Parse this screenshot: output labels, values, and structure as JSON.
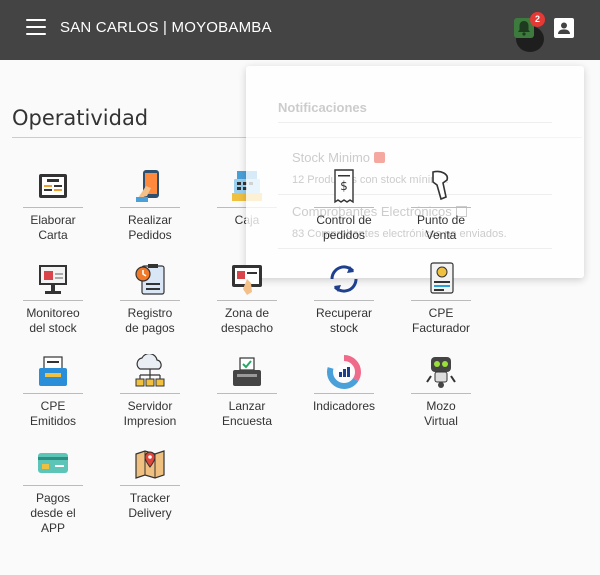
{
  "header": {
    "title": "SAN CARLOS | MOYOBAMBA",
    "notification_count": "2",
    "icons": [
      "menu-icon",
      "bell-icon",
      "user-icon"
    ]
  },
  "section": {
    "title": "Operatividad"
  },
  "tiles": [
    {
      "label": "Elaborar\nCarta",
      "icon": "menu-board-icon"
    },
    {
      "label": "Realizar\nPedidos",
      "icon": "tablet-hand-icon"
    },
    {
      "label": "Caja",
      "icon": "cash-register-icon"
    },
    {
      "label": "Control de\npedidos",
      "icon": "receipt-icon"
    },
    {
      "label": "Punto de\nVenta",
      "icon": "barcode-scanner-icon"
    },
    {
      "label": "Monitoreo\ndel stock",
      "icon": "monitor-chart-icon"
    },
    {
      "label": "Registro\nde pagos",
      "icon": "clipboard-clock-icon"
    },
    {
      "label": "Zona de\ndespacho",
      "icon": "dispatch-screen-icon"
    },
    {
      "label": "Recuperar\nstock",
      "icon": "refresh-icon"
    },
    {
      "label": "CPE\nFacturador",
      "icon": "invoice-icon"
    },
    {
      "label": "CPE\nEmitidos",
      "icon": "inbox-tray-icon"
    },
    {
      "label": "Servidor\nImpresion",
      "icon": "cloud-server-icon"
    },
    {
      "label": "Lanzar\nEncuesta",
      "icon": "ballot-box-icon"
    },
    {
      "label": "Indicadores",
      "icon": "donut-chart-icon"
    },
    {
      "label": "Mozo\nVirtual",
      "icon": "robot-icon"
    },
    {
      "label": "Pagos\ndesde el\nAPP",
      "icon": "card-icon"
    },
    {
      "label": "Tracker\nDelivery",
      "icon": "map-pin-icon"
    }
  ],
  "notifications": {
    "title": "Notificaciones",
    "items": [
      {
        "title": "Stock Minimo",
        "desc": "12 Productos con stock mínimo."
      },
      {
        "title": "Comprobantes Electrónicos",
        "desc": "83 Comprobantes electrónicos no enviados."
      }
    ]
  },
  "colors": {
    "topbar": "#444444",
    "badge": "#e53935",
    "bell_bg": "#3d7a3d"
  }
}
